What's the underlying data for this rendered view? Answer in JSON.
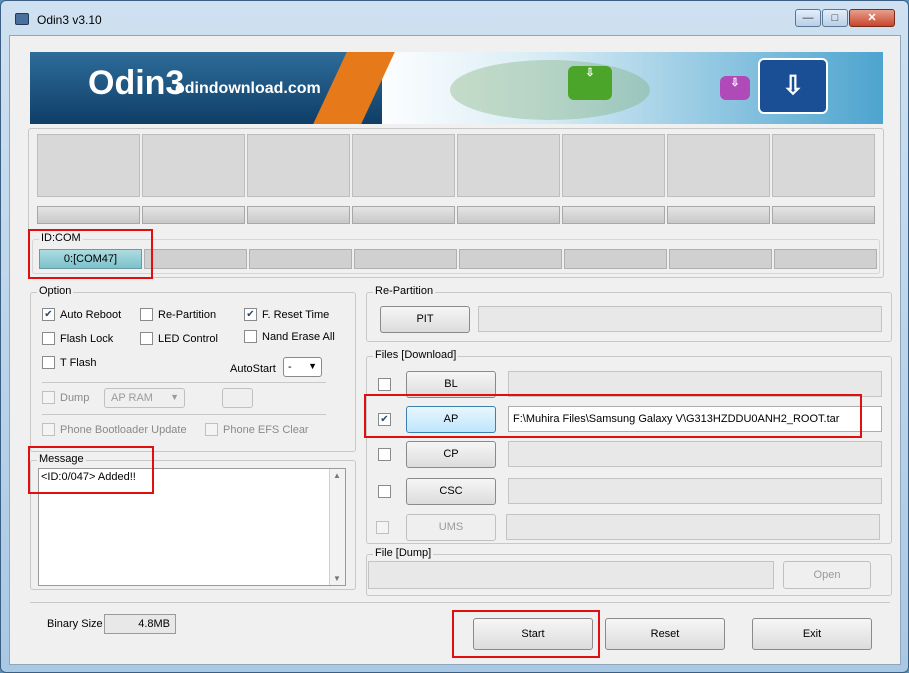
{
  "window": {
    "title": "Odin3 v3.10",
    "minimize": "—",
    "maximize": "□",
    "close": "✕"
  },
  "banner": {
    "logo": "Odin3",
    "url": "odindownload.com"
  },
  "id_com": {
    "label": "ID:COM",
    "cells": [
      "0:[COM47]",
      "",
      "",
      "",
      "",
      "",
      "",
      ""
    ]
  },
  "option": {
    "legend": "Option",
    "auto_reboot": "Auto Reboot",
    "re_partition": "Re-Partition",
    "f_reset_time": "F. Reset Time",
    "flash_lock": "Flash Lock",
    "led_control": "LED Control",
    "nand_erase_all": "Nand Erase All",
    "t_flash": "T Flash",
    "autostart_label": "AutoStart",
    "autostart_value": "-",
    "dump": "Dump",
    "dump_select": "AP RAM",
    "phone_bootloader_update": "Phone Bootloader Update",
    "phone_efs_clear": "Phone EFS Clear"
  },
  "message": {
    "legend": "Message",
    "text": "<ID:0/047> Added!!"
  },
  "re_partition_panel": {
    "legend": "Re-Partition",
    "pit": "PIT"
  },
  "files": {
    "legend": "Files [Download]",
    "rows": [
      {
        "label": "BL",
        "path": "",
        "checked": false
      },
      {
        "label": "AP",
        "path": "F:\\Muhira Files\\Samsung Galaxy V\\G313HZDDU0ANH2_ROOT.tar",
        "checked": true
      },
      {
        "label": "CP",
        "path": "",
        "checked": false
      },
      {
        "label": "CSC",
        "path": "",
        "checked": false
      },
      {
        "label": "UMS",
        "path": "",
        "checked": false
      }
    ]
  },
  "dump_panel": {
    "legend": "File [Dump]",
    "open": "Open"
  },
  "binary": {
    "label": "Binary Size",
    "value": "4.8MB"
  },
  "actions": {
    "start": "Start",
    "reset": "Reset",
    "exit": "Exit"
  },
  "colors": {
    "highlight_red": "#e01010",
    "com_active": "#7cc2cc"
  }
}
